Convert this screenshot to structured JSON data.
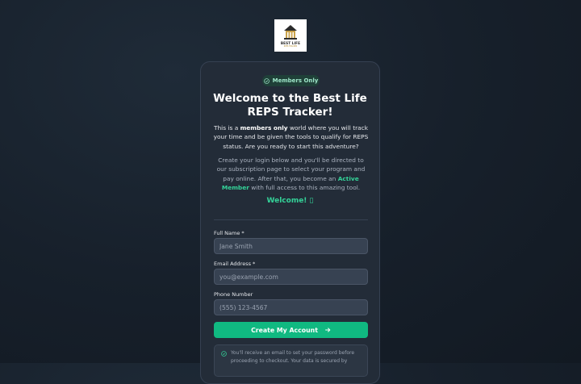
{
  "logo": {
    "brand": "BEST LIFE",
    "tag": "REPS TRACKER"
  },
  "badge": {
    "label": "Members Only",
    "icon": "shield-check-icon"
  },
  "title_line1": "Welcome to the Best Life",
  "title_line2": "REPS Tracker!",
  "intro": {
    "part1": "This is a ",
    "bold": "members only",
    "part2": " world where you will track your time and be given the tools to qualify for REPS status. Are you ready to start this adventure?"
  },
  "info": {
    "part1": "Create your login below and you'll be directed to our subscription page to select your program and pay online. After that, you become an ",
    "highlight": "Active Member",
    "part2": " with full access to this amazing tool."
  },
  "welcome": "Welcome! ▯",
  "form": {
    "full_name_label": "Full Name *",
    "full_name_placeholder": "Jane Smith",
    "email_label": "Email Address *",
    "email_placeholder": "you@example.com",
    "phone_label": "Phone Number",
    "phone_placeholder": "(555) 123-4567",
    "submit_label": "Create My Account"
  },
  "notice": {
    "line1": "You'll receive an email to set your password before",
    "line2": "proceeding to checkout. Your data is secured by"
  },
  "colors": {
    "accent": "#10b981",
    "highlight": "#34d399",
    "card": "#232c38",
    "background": "#17202b"
  }
}
